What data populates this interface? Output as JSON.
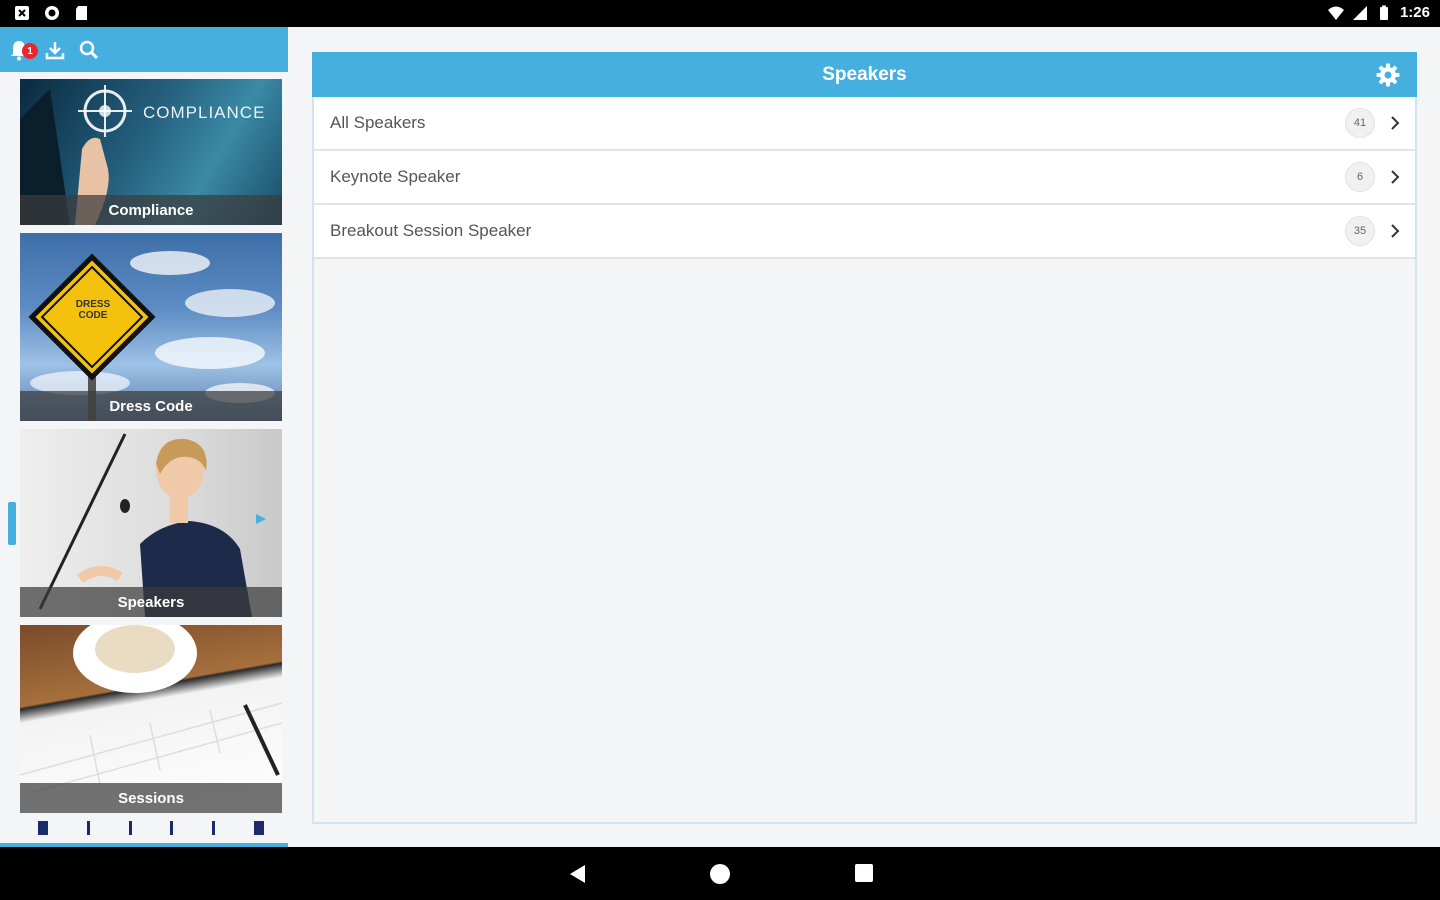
{
  "status_bar": {
    "time": "1:26",
    "left_icons": [
      "notification-square-icon",
      "circle-app-icon",
      "sd-card-icon"
    ],
    "right_icons": [
      "wifi-icon",
      "signal-icon",
      "battery-icon"
    ]
  },
  "sidebar": {
    "notification_count": "1",
    "toolbar_icons": [
      "bell-icon",
      "download-icon",
      "search-icon"
    ],
    "tiles": [
      {
        "label": "Compliance",
        "image_text": "COMPLIANCE"
      },
      {
        "label": "Dress Code",
        "image_text": "DRESS CODE"
      },
      {
        "label": "Speakers"
      },
      {
        "label": "Sessions"
      }
    ]
  },
  "panel": {
    "title": "Speakers",
    "rows": [
      {
        "label": "All Speakers",
        "count": "41"
      },
      {
        "label": "Keynote Speaker",
        "count": "6"
      },
      {
        "label": "Breakout Session Speaker",
        "count": "35"
      }
    ]
  },
  "colors": {
    "accent": "#45b0e0",
    "badge": "#e8262b",
    "background": "#f4f5f6"
  }
}
